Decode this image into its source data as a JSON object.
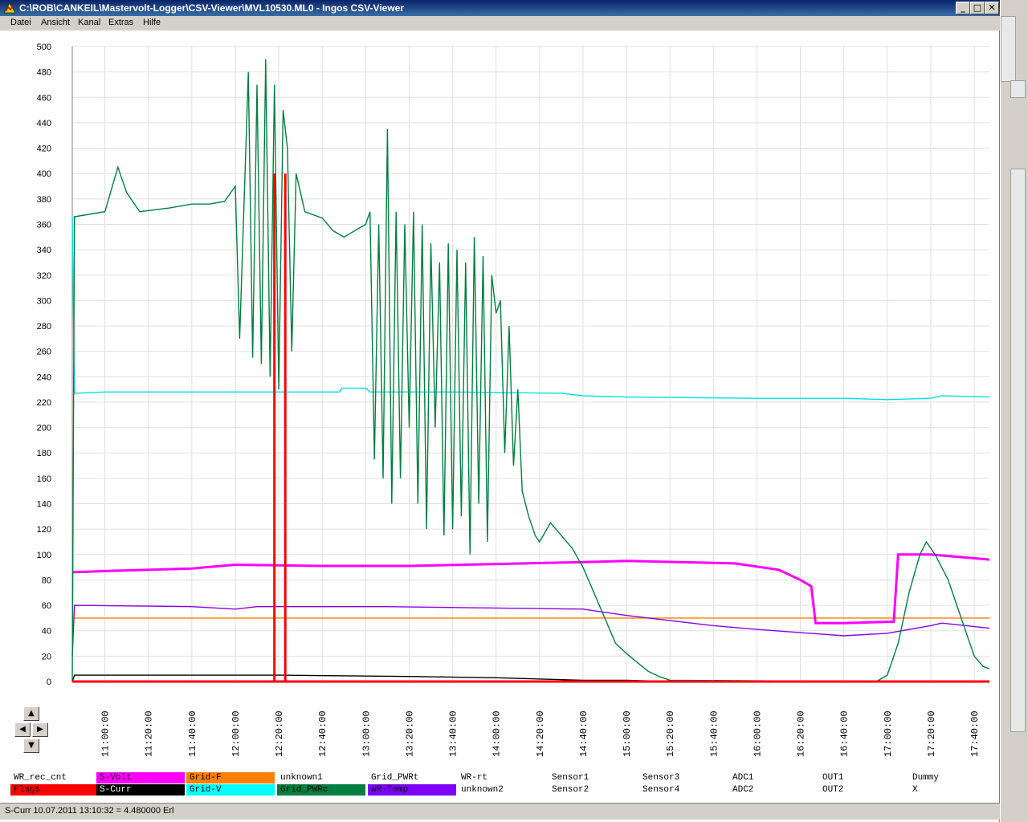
{
  "window": {
    "title": "C:\\ROB\\CANKEIL\\Mastervolt-Logger\\CSV-Viewer\\MVL10530.ML0 - Ingos CSV-Viewer"
  },
  "menu": [
    "Datei",
    "Ansicht",
    "Kanal",
    "Extras",
    "Hilfe"
  ],
  "status": {
    "text": "S-Curr 10.07.2011 13:10:32 = 4.480000 Erl"
  },
  "legend": [
    {
      "label": "WR_rec_cnt",
      "color": "#ffffff"
    },
    {
      "label": "S-Volt",
      "color": "#ff00ff"
    },
    {
      "label": "Grid-F",
      "color": "#ff7f00"
    },
    {
      "label": "unknown1",
      "color": "#ffffff"
    },
    {
      "label": "Grid_PWRt",
      "color": "#ffffff"
    },
    {
      "label": "WR-rt",
      "color": "#ffffff"
    },
    {
      "label": "Sensor1",
      "color": "#ffffff"
    },
    {
      "label": "Sensor3",
      "color": "#ffffff"
    },
    {
      "label": "ADC1",
      "color": "#ffffff"
    },
    {
      "label": "OUT1",
      "color": "#ffffff"
    },
    {
      "label": "Dummy",
      "color": "#ffffff"
    },
    {
      "label": "Flags",
      "color": "#ff0000"
    },
    {
      "label": "S-Curr",
      "color": "#000000"
    },
    {
      "label": "Grid-V",
      "color": "#00ffff"
    },
    {
      "label": "Grid_PWRc",
      "color": "#007f3f"
    },
    {
      "label": "WR-Temp",
      "color": "#7f00ff"
    },
    {
      "label": "unknown2",
      "color": "#ffffff"
    },
    {
      "label": "Sensor2",
      "color": "#ffffff"
    },
    {
      "label": "Sensor4",
      "color": "#ffffff"
    },
    {
      "label": "ADC2",
      "color": "#ffffff"
    },
    {
      "label": "OUT2",
      "color": "#ffffff"
    },
    {
      "label": "X",
      "color": "#ffffff"
    }
  ],
  "chart_data": {
    "type": "line",
    "ylim": [
      0,
      500
    ],
    "yticks": [
      "500",
      "480",
      "460",
      "440",
      "420",
      "400",
      "380",
      "360",
      "340",
      "320",
      "300",
      "280",
      "260",
      "240",
      "220",
      "200",
      "180",
      "160",
      "140",
      "120",
      "100",
      "80",
      "60",
      "40",
      "20",
      "0"
    ],
    "xticks": [
      "11:00:00",
      "11:20:00",
      "11:40:00",
      "12:00:00",
      "12:20:00",
      "12:40:00",
      "13:00:00",
      "13:20:00",
      "13:40:00",
      "14:00:00",
      "14:20:00",
      "14:40:00",
      "15:00:00",
      "15:20:00",
      "15:40:00",
      "16:00:00",
      "16:20:00",
      "16:40:00",
      "17:00:00",
      "17:20:00",
      "17:40:00"
    ],
    "xlim_minutes": [
      645,
      1067
    ],
    "grid": true,
    "series": [
      {
        "name": "Grid-V",
        "color": "#00e0e0",
        "points": [
          [
            645,
            366
          ],
          [
            646,
            227
          ],
          [
            660,
            228
          ],
          [
            690,
            228
          ],
          [
            720,
            228
          ],
          [
            750,
            228
          ],
          [
            768,
            228
          ],
          [
            769,
            231
          ],
          [
            780,
            231
          ],
          [
            782,
            228
          ],
          [
            820,
            228
          ],
          [
            870,
            227
          ],
          [
            880,
            225
          ],
          [
            900,
            224
          ],
          [
            960,
            223
          ],
          [
            1000,
            223
          ],
          [
            1020,
            222
          ],
          [
            1040,
            223
          ],
          [
            1045,
            225
          ],
          [
            1067,
            224
          ]
        ]
      },
      {
        "name": "Grid-F",
        "color": "#ff7f00",
        "points": [
          [
            645,
            50
          ],
          [
            1067,
            50
          ]
        ]
      },
      {
        "name": "WR-Temp",
        "color": "#8a00e6",
        "points": [
          [
            645,
            20
          ],
          [
            646,
            60
          ],
          [
            700,
            59
          ],
          [
            720,
            57
          ],
          [
            730,
            59
          ],
          [
            790,
            59
          ],
          [
            880,
            57
          ],
          [
            900,
            52
          ],
          [
            920,
            48
          ],
          [
            940,
            44
          ],
          [
            960,
            41
          ],
          [
            1000,
            36
          ],
          [
            1020,
            38
          ],
          [
            1040,
            44
          ],
          [
            1045,
            46
          ],
          [
            1067,
            42
          ]
        ]
      },
      {
        "name": "S-Volt",
        "color": "#ff00ff",
        "points": [
          [
            645,
            86
          ],
          [
            660,
            87
          ],
          [
            700,
            89
          ],
          [
            720,
            92
          ],
          [
            760,
            91
          ],
          [
            800,
            91
          ],
          [
            880,
            94
          ],
          [
            900,
            95
          ],
          [
            950,
            93
          ],
          [
            970,
            88
          ],
          [
            980,
            80
          ],
          [
            985,
            75
          ],
          [
            987,
            46
          ],
          [
            1000,
            46
          ],
          [
            1020,
            47
          ],
          [
            1023,
            47
          ],
          [
            1025,
            100
          ],
          [
            1040,
            100
          ],
          [
            1067,
            96
          ]
        ]
      },
      {
        "name": "S-Curr",
        "color": "#000000",
        "points": [
          [
            645,
            0
          ],
          [
            646,
            5
          ],
          [
            700,
            5
          ],
          [
            740,
            5
          ],
          [
            800,
            4
          ],
          [
            840,
            3
          ],
          [
            880,
            1
          ],
          [
            900,
            1
          ],
          [
            920,
            0
          ],
          [
            1067,
            0
          ]
        ]
      },
      {
        "name": "Grid_PWRc",
        "color": "#007f3f",
        "points": [
          [
            645,
            0
          ],
          [
            646,
            366
          ],
          [
            660,
            370
          ],
          [
            666,
            405
          ],
          [
            670,
            385
          ],
          [
            676,
            370
          ],
          [
            690,
            373
          ],
          [
            700,
            376
          ],
          [
            708,
            376
          ],
          [
            715,
            378
          ],
          [
            720,
            390
          ],
          [
            722,
            270
          ],
          [
            726,
            480
          ],
          [
            728,
            255
          ],
          [
            730,
            470
          ],
          [
            732,
            250
          ],
          [
            734,
            490
          ],
          [
            736,
            240
          ],
          [
            738,
            470
          ],
          [
            740,
            230
          ],
          [
            742,
            450
          ],
          [
            744,
            420
          ],
          [
            746,
            260
          ],
          [
            748,
            400
          ],
          [
            752,
            370
          ],
          [
            760,
            365
          ],
          [
            765,
            355
          ],
          [
            770,
            350
          ],
          [
            775,
            355
          ],
          [
            780,
            360
          ],
          [
            782,
            370
          ],
          [
            784,
            175
          ],
          [
            786,
            360
          ],
          [
            788,
            160
          ],
          [
            790,
            435
          ],
          [
            792,
            140
          ],
          [
            794,
            370
          ],
          [
            796,
            160
          ],
          [
            798,
            360
          ],
          [
            800,
            200
          ],
          [
            802,
            370
          ],
          [
            804,
            140
          ],
          [
            806,
            360
          ],
          [
            808,
            120
          ],
          [
            810,
            345
          ],
          [
            812,
            200
          ],
          [
            814,
            330
          ],
          [
            816,
            115
          ],
          [
            818,
            345
          ],
          [
            820,
            120
          ],
          [
            822,
            340
          ],
          [
            824,
            130
          ],
          [
            826,
            330
          ],
          [
            828,
            100
          ],
          [
            830,
            350
          ],
          [
            832,
            140
          ],
          [
            834,
            335
          ],
          [
            836,
            110
          ],
          [
            838,
            320
          ],
          [
            840,
            290
          ],
          [
            842,
            300
          ],
          [
            844,
            180
          ],
          [
            846,
            280
          ],
          [
            848,
            170
          ],
          [
            850,
            230
          ],
          [
            852,
            150
          ],
          [
            855,
            130
          ],
          [
            858,
            115
          ],
          [
            860,
            110
          ],
          [
            865,
            125
          ],
          [
            870,
            115
          ],
          [
            875,
            105
          ],
          [
            880,
            90
          ],
          [
            885,
            70
          ],
          [
            890,
            50
          ],
          [
            895,
            30
          ],
          [
            900,
            22
          ],
          [
            905,
            15
          ],
          [
            910,
            8
          ],
          [
            915,
            4
          ],
          [
            920,
            1
          ],
          [
            1010,
            0
          ],
          [
            1015,
            0
          ],
          [
            1020,
            5
          ],
          [
            1025,
            30
          ],
          [
            1030,
            70
          ],
          [
            1035,
            100
          ],
          [
            1038,
            110
          ],
          [
            1042,
            100
          ],
          [
            1048,
            80
          ],
          [
            1052,
            60
          ],
          [
            1056,
            40
          ],
          [
            1060,
            20
          ],
          [
            1064,
            12
          ],
          [
            1067,
            10
          ]
        ]
      },
      {
        "name": "Flags",
        "color": "#ff0000",
        "points": [
          [
            645,
            0
          ],
          [
            1067,
            0
          ]
        ]
      }
    ],
    "flag_markers": [
      738,
      743
    ]
  }
}
